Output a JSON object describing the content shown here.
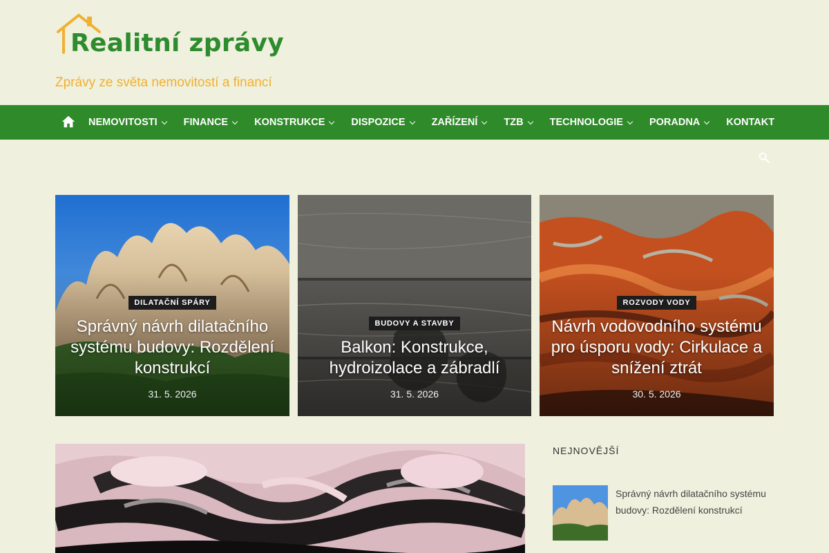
{
  "site": {
    "logo_text": "Realitní zprávy",
    "tagline": "Zprávy ze světa nemovitostí a financí",
    "colors": {
      "brand_green": "#2f8a2a",
      "logo_green": "#2e8b2e",
      "accent_orange": "#f0b030",
      "background": "#eff0dd"
    }
  },
  "nav": {
    "home_icon": "home-icon",
    "items": [
      {
        "label": "NEMOVITOSTI",
        "has_dropdown": true
      },
      {
        "label": "FINANCE",
        "has_dropdown": true
      },
      {
        "label": "KONSTRUKCE",
        "has_dropdown": true
      },
      {
        "label": "DISPOZICE",
        "has_dropdown": true
      },
      {
        "label": "ZAŘÍZENÍ",
        "has_dropdown": true
      },
      {
        "label": "TZB",
        "has_dropdown": true
      },
      {
        "label": "TECHNOLOGIE",
        "has_dropdown": true
      },
      {
        "label": "PORADNA",
        "has_dropdown": true
      },
      {
        "label": "KONTAKT",
        "has_dropdown": false
      }
    ],
    "search_icon": "search-icon"
  },
  "featured": [
    {
      "category": "DILATAČNÍ SPÁRY",
      "title": "Správný návrh dilatačního systému budovy: Rozdělení konstrukcí",
      "date": "31. 5. 2026"
    },
    {
      "category": "BUDOVY A STAVBY",
      "title": "Balkon: Konstrukce, hydroizolace a zábradlí",
      "date": "31. 5. 2026"
    },
    {
      "category": "ROZVODY VODY",
      "title": "Návrh vodovodního systému pro úsporu vody: Cirkulace a snížení ztrát",
      "date": "30. 5. 2026"
    }
  ],
  "sidebar": {
    "title": "NEJNOVĚJŠÍ",
    "posts": [
      {
        "title": "Správný návrh dilatačního systému budovy: Rozdělení konstrukcí"
      }
    ]
  }
}
